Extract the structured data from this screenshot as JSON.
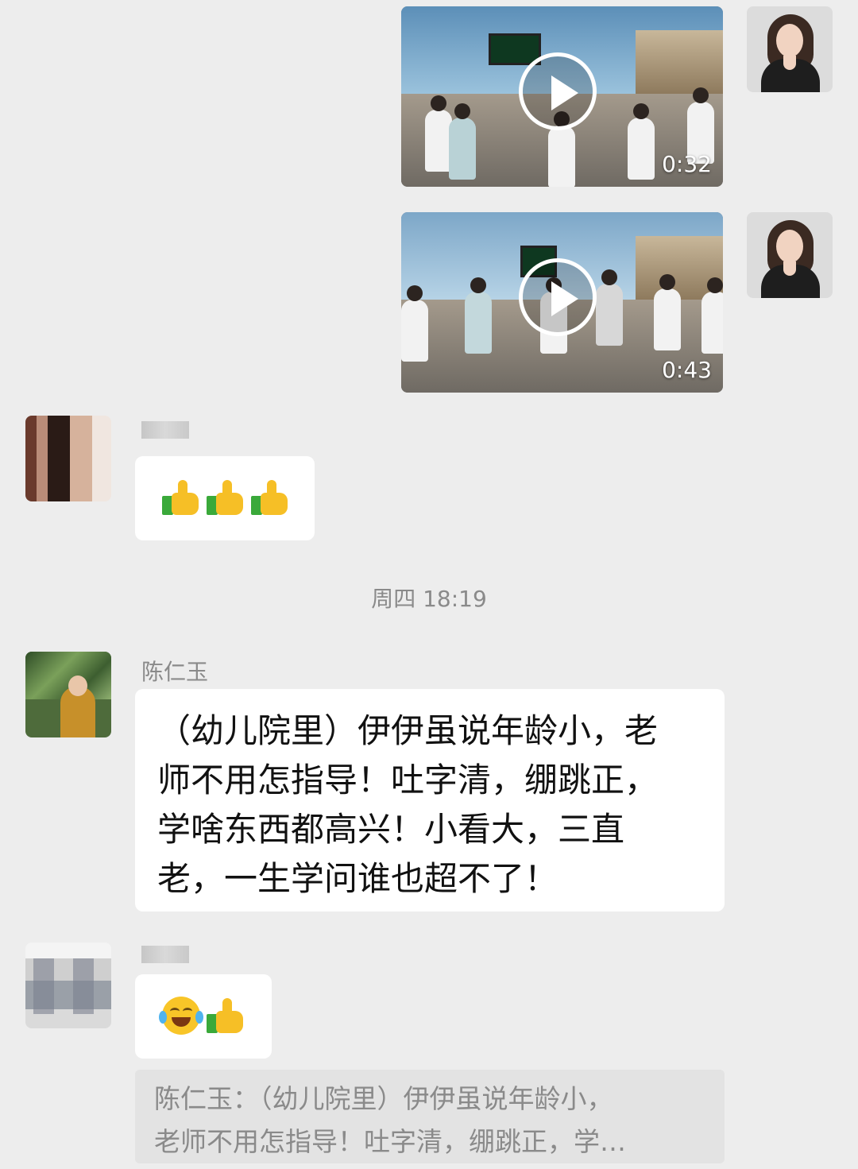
{
  "videos": [
    {
      "duration": "0:32"
    },
    {
      "duration": "0:43"
    }
  ],
  "messages": {
    "emoji_reply_1": "👍👍👍",
    "time_separator": "周四 18:19",
    "chen": {
      "name": "陈仁玉",
      "lines": [
        "（幼儿院里）伊伊虽说年龄小，老",
        "师不用怎指导！吐字清，绷跳正，",
        "学啥东西都高兴！小看大，三直",
        "老，一生学问谁也超不了！"
      ]
    },
    "emoji_reply_2": "😂👍",
    "quote": {
      "lines": [
        "陈仁玉：（幼儿院里）伊伊虽说年龄小，",
        "老师不用怎指导！吐字清，绷跳正，学…"
      ]
    }
  },
  "icons": [
    "play-icon",
    "thumbs-up-icon",
    "laughing-crying-icon"
  ]
}
